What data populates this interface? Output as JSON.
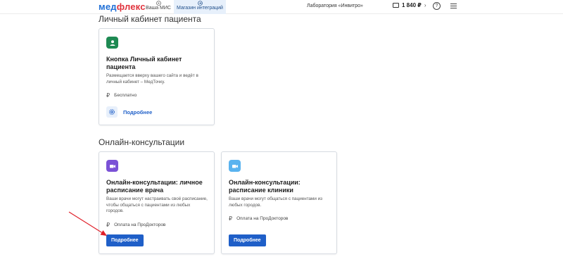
{
  "header": {
    "logo_part1": "мед",
    "logo_part2": "флекс",
    "nav_mis": "Ваша МИС",
    "nav_shop": "Магазин интеграций",
    "lab": "Лаборатория «Инвитро»",
    "balance": "1 840 ₽",
    "balance_chevron": "›",
    "help": "?"
  },
  "sections": {
    "patient_cabinet": "Личный кабинет пациента",
    "online_consult": "Онлайн-консультации"
  },
  "cards": {
    "patient_button": {
      "title": "Кнопка Личный кабинет пациента",
      "description": "Размещается вверху вашего сайта и ведёт в личный кабинет – МедТочку.",
      "price": "Бесплатно",
      "more": "Подробнее",
      "accent": "#1e8a53"
    },
    "doctor_schedule": {
      "title": "Онлайн-консультации: личное расписание врача",
      "description": "Ваши врачи могут настраивать своё расписание, чтобы общаться с пациентами из любых городов.",
      "price": "Оплата на ПроДокторов",
      "more": "Подробнее",
      "accent": "#7b52d6"
    },
    "clinic_schedule": {
      "title": "Онлайн-консультации: расписание клиники",
      "description": "Ваши врачи могут общаться с пациентами из любых городов.",
      "price": "Оплата на ПроДокторов",
      "more": "Подробнее",
      "accent": "#5ab3ef"
    }
  },
  "currency_symbol": "₽",
  "annotation_color": "#e0202a"
}
